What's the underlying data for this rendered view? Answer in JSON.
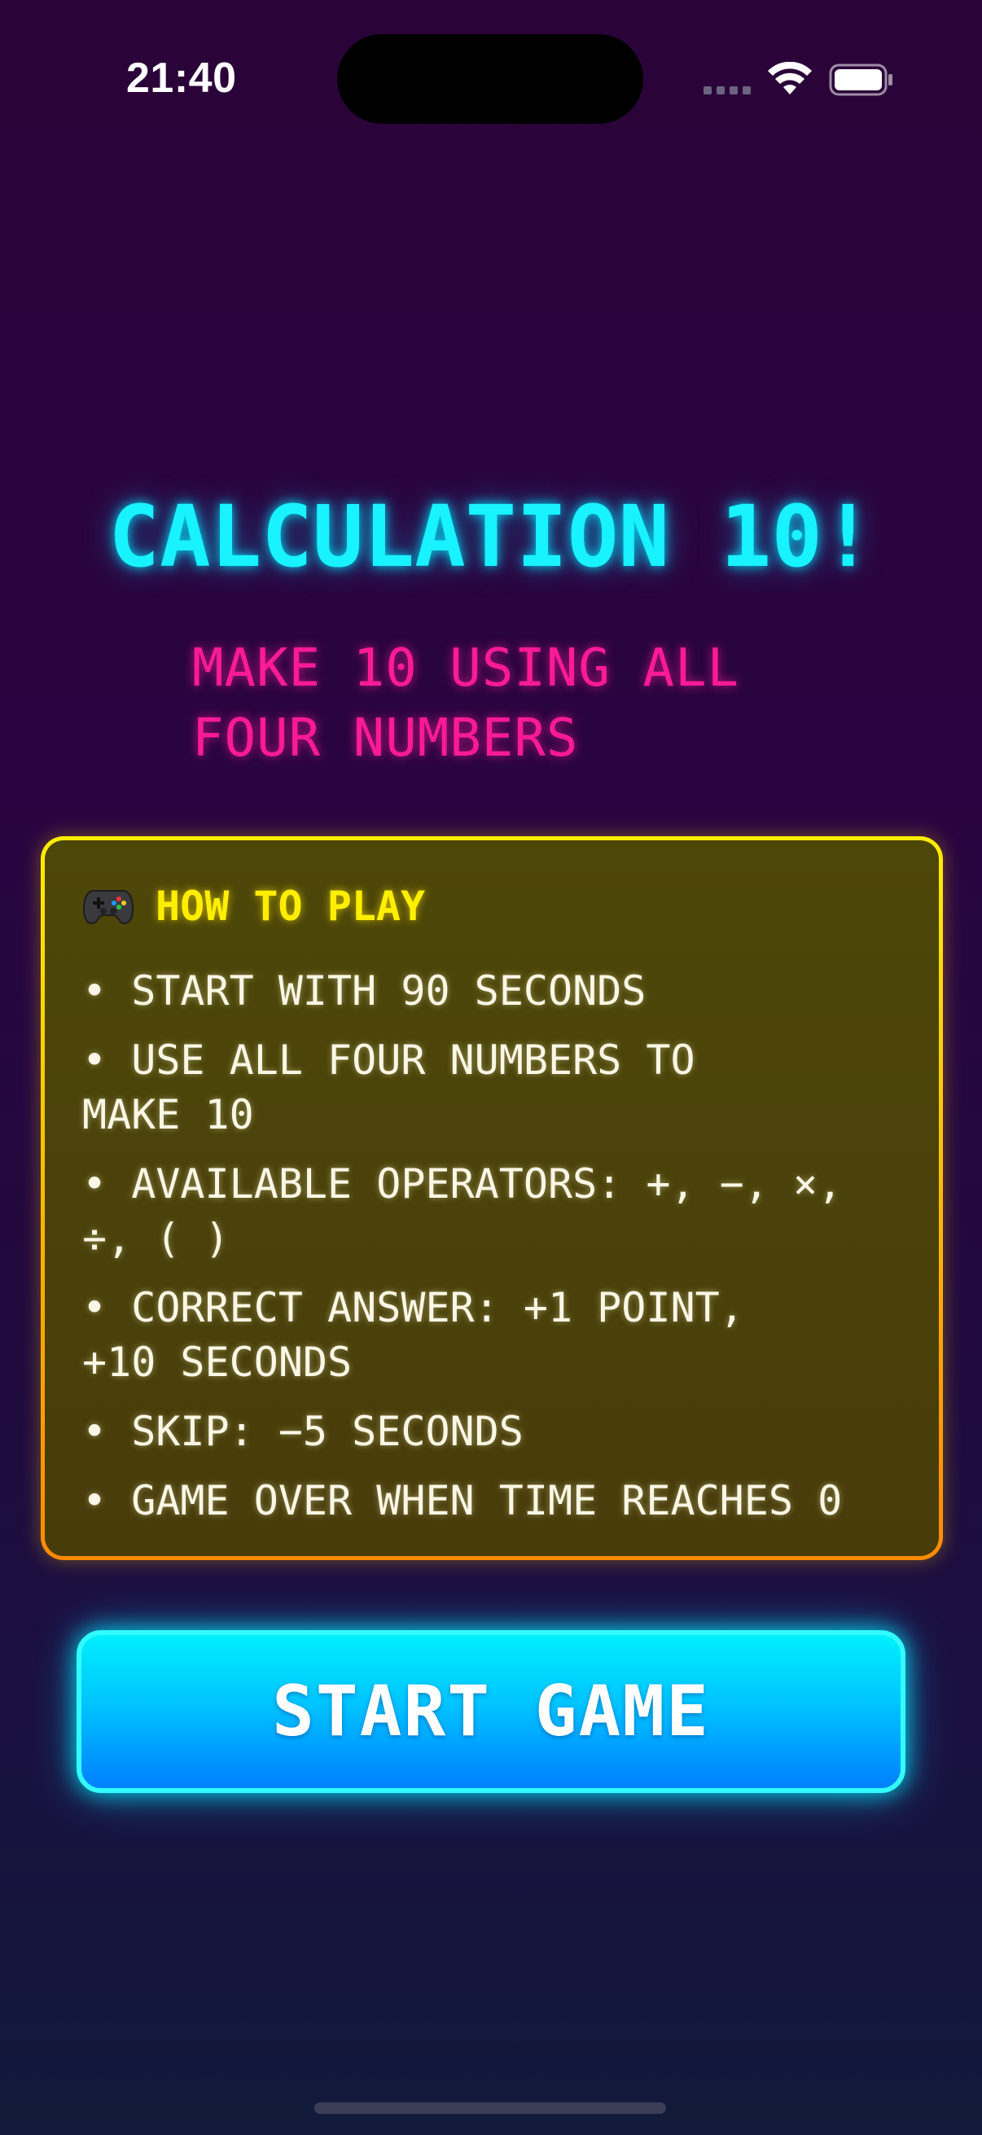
{
  "status_bar": {
    "time": "21:40",
    "icons": [
      "signal-icon",
      "wifi-icon",
      "battery-icon"
    ]
  },
  "title": "CALCULATION 10!",
  "subtitle": "MAKE 10 USING ALL\nFOUR NUMBERS",
  "how_to_play": {
    "icon": "gamepad-icon",
    "title": "HOW TO PLAY",
    "rules": [
      "START WITH 90 SECONDS",
      "USE ALL FOUR NUMBERS TO\nMAKE 10",
      "AVAILABLE OPERATORS: +, −, ×,\n÷, ( )",
      "CORRECT ANSWER: +1 POINT,\n+10 SECONDS",
      "SKIP: −5 SECONDS",
      "GAME OVER WHEN TIME REACHES 0"
    ]
  },
  "start_button": {
    "label": "START GAME"
  },
  "colors": {
    "title": "#19f2ff",
    "subtitle": "#ff1a99",
    "card_title": "#ffee00",
    "card_border_top": "#ffee00",
    "card_border_bottom": "#ff8a00",
    "button_top": "#00f0ff",
    "button_bottom": "#0080ff",
    "background_top": "#2a0438",
    "background_bottom": "#111a3a"
  }
}
